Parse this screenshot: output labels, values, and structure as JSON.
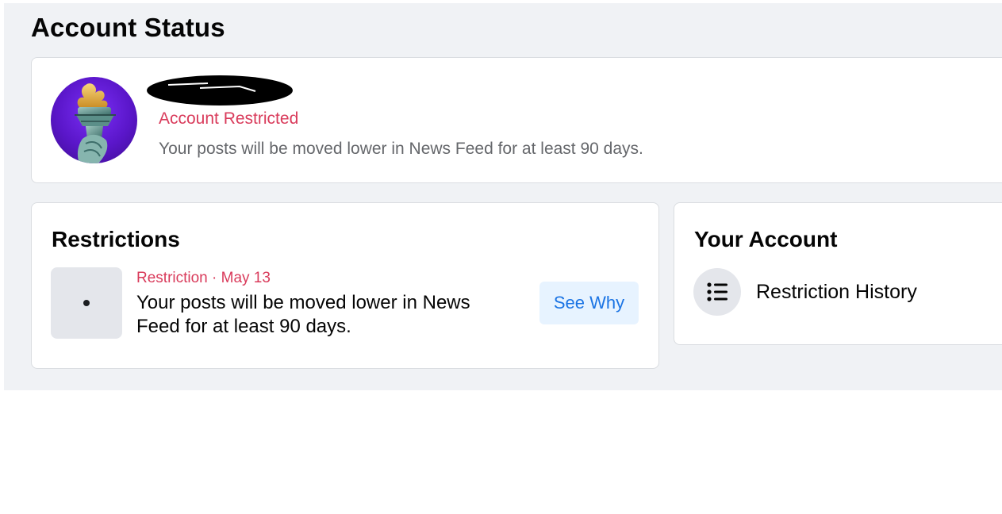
{
  "page": {
    "title": "Account Status"
  },
  "status_card": {
    "status_label": "Account Restricted",
    "description": "Your posts will be moved lower in News Feed for at least 90 days.",
    "colors": {
      "status": "#d93b5b",
      "description": "#65676b"
    }
  },
  "restrictions": {
    "title": "Restrictions",
    "items": [
      {
        "meta": "Restriction · May 13",
        "text": "Your posts will be moved lower in News Feed for at least 90 days.",
        "button_label": "See Why"
      }
    ]
  },
  "your_account": {
    "title": "Your Account",
    "items": [
      {
        "label": "Restriction History",
        "icon": "list-icon"
      }
    ]
  },
  "colors": {
    "background": "#f0f2f5",
    "card": "#ffffff",
    "accent": "#1b74e4",
    "button_bg": "#e7f3ff"
  }
}
